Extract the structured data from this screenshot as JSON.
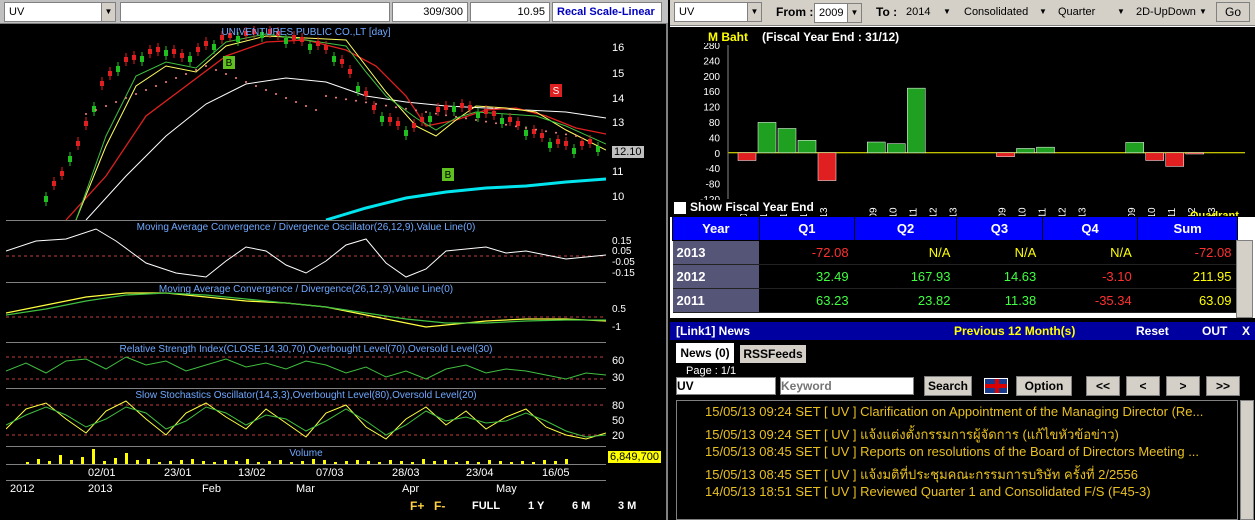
{
  "chart": {
    "symbol": "UV",
    "bars_info": "309/300",
    "last_value": "10.95",
    "scale_button": "Recal Scale-Linear",
    "main_title": "UNIVENTURES PUBLIC CO.,LT [day]",
    "y_labels": [
      "16",
      "15",
      "14",
      "13",
      "12",
      "11",
      "10"
    ],
    "current_price": "12.10",
    "buy_marker": "B",
    "sell_marker": "S",
    "macd_title": "Moving Average Convergence / Divergence Oscillator(26,12,9),Value Line(0)",
    "macd_labels": [
      "0.15",
      "0.05",
      "-0.05",
      "-0.15"
    ],
    "macd2_title": "Moving Average Convergence / Divergence(26,12,9),Value Line(0)",
    "macd2_labels": [
      "0.5",
      "-1"
    ],
    "rsi_title": "Relative Strength Index(CLOSE,14,30,70),Overbought Level(70),Oversold Level(30)",
    "rsi_labels": [
      "60",
      "30"
    ],
    "stoch_title": "Slow Stochastics Oscillator(14,3,3),Overbought Level(80),Oversold Level(20)",
    "stoch_labels": [
      "80",
      "50",
      "20"
    ],
    "volume_title": "Volume",
    "volume_value": "6,849,700",
    "dates": [
      "02/01",
      "23/01",
      "13/02",
      "07/03",
      "28/03",
      "23/04",
      "16/05"
    ],
    "months": [
      "2012",
      "2013",
      "Feb",
      "Mar",
      "Apr",
      "May"
    ],
    "timeframes": [
      "FULL",
      "1 Y",
      "6 M",
      "3 M"
    ],
    "zoom_plus": "F+",
    "zoom_minus": "F-"
  },
  "fin": {
    "symbol": "UV",
    "from_label": "From :",
    "from_value": "2009",
    "to_label": "To :",
    "to_value": "2014",
    "type": "Consolidated",
    "period": "Quarter",
    "view": "2D-UpDown",
    "go": "Go",
    "unit": "M Baht",
    "fiscal": "(Fiscal Year End : 31/12)",
    "show_fiscal": "Show Fiscal Year End",
    "quadrant_label": "Quadrant",
    "headers": [
      "Year",
      "Q1",
      "Q2",
      "Q3",
      "Q4",
      "Sum"
    ],
    "rows": [
      {
        "year": "2013",
        "q1": "-72.08",
        "q2": "N/A",
        "q3": "N/A",
        "q4": "N/A",
        "sum": "-72.08"
      },
      {
        "year": "2012",
        "q1": "32.49",
        "q2": "167.93",
        "q3": "14.63",
        "q4": "-3.10",
        "sum": "211.95"
      },
      {
        "year": "2011",
        "q1": "63.23",
        "q2": "23.82",
        "q3": "11.38",
        "q4": "-35.34",
        "sum": "63.09"
      }
    ],
    "y_ticks": [
      "280",
      "240",
      "200",
      "160",
      "120",
      "80",
      "40",
      "0",
      "-40",
      "-80",
      "-120"
    ],
    "x_groups": [
      "1Q",
      "2Q",
      "3Q",
      "4Q"
    ],
    "x_years": [
      "09",
      "10",
      "11",
      "12",
      "13"
    ]
  },
  "chart_data": {
    "type": "bar",
    "title": "(Fiscal Year End : 31/12)",
    "ylabel": "M Baht",
    "ylim": [
      -120,
      280
    ],
    "groups": [
      {
        "name": "1Q",
        "categories": [
          "09",
          "10",
          "11",
          "12",
          "13"
        ],
        "values": [
          -20,
          79,
          63.23,
          32.49,
          -72.08
        ]
      },
      {
        "name": "2Q",
        "categories": [
          "09",
          "10",
          "11",
          "12",
          "13"
        ],
        "values": [
          28,
          23.82,
          167.93,
          0,
          0
        ]
      },
      {
        "name": "3Q",
        "categories": [
          "09",
          "10",
          "11",
          "12",
          "13"
        ],
        "values": [
          -10,
          11.38,
          14.63,
          0,
          0
        ]
      },
      {
        "name": "4Q",
        "categories": [
          "09",
          "10",
          "11",
          "12",
          "13"
        ],
        "values": [
          27,
          -20,
          -35.34,
          -3.1,
          0
        ]
      }
    ]
  },
  "news": {
    "header": "[Link1] News",
    "previous": "Previous 12 Month(s)",
    "reset": "Reset",
    "out": "OUT",
    "close": "X",
    "tab_news": "News (0)",
    "tab_rss": "RSSFeeds",
    "page": "Page : 1/1",
    "symbol": "UV",
    "keyword_placeholder": "Keyword",
    "search": "Search",
    "option": "Option",
    "nav": [
      "<<",
      "<",
      ">",
      ">>"
    ],
    "items": [
      "15/05/13 09:24  SET  [ UV ]  Clarification on Appointment of the Managing Director (Re...",
      "15/05/13 09:24  SET  [ UV ]  แจ้งแต่งตั้งกรรมการผู้จัดการ (แก้ไขหัวข้อข่าว)",
      "15/05/13 08:45  SET  [ UV ]  Reports on resolutions of the Board of Directors  Meeting ...",
      "15/05/13 08:45  SET  [ UV ]  แจ้งมติที่ประชุมคณะกรรมการบริษัท ครั้งที่ 2/2556",
      "14/05/13 18:51  SET  [ UV ]  Reviewed Quarter 1 and Consolidated F/S (F45-3)"
    ]
  }
}
